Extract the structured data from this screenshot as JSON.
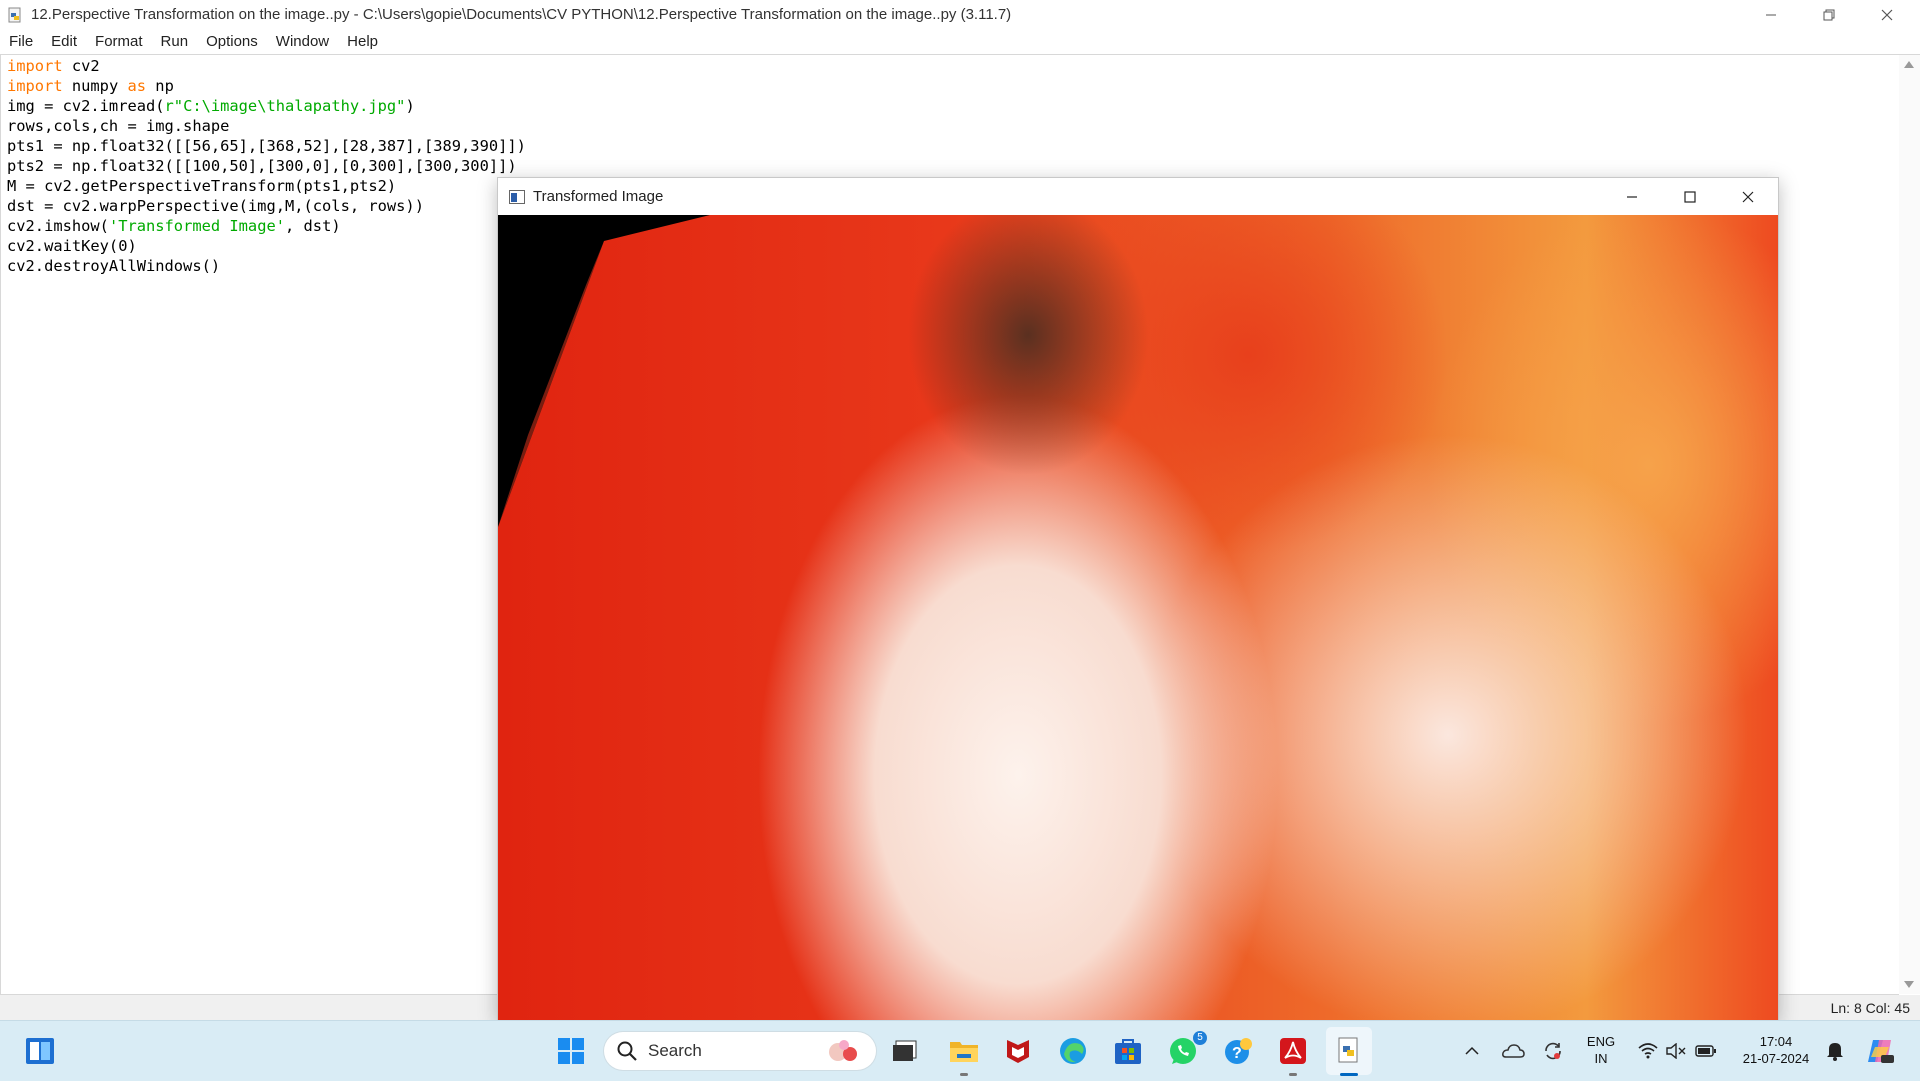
{
  "idle": {
    "title": "12.Perspective Transformation on the image..py - C:\\Users\\gopie\\Documents\\CV PYTHON\\12.Perspective Transformation on the image..py (3.11.7)",
    "menu": [
      "File",
      "Edit",
      "Format",
      "Run",
      "Options",
      "Window",
      "Help"
    ],
    "status": "Ln: 8   Col: 45",
    "code": [
      {
        "kw": "import",
        "rest": " cv2"
      },
      {
        "kw": "import",
        "mid": " numpy ",
        "kw2": "as",
        "rest": " np"
      },
      {
        "pre": "img = cv2.imread(",
        "str": "r\"C:\\image\\thalapathy.jpg\"",
        "post": ")"
      },
      {
        "plain": "rows,cols,ch = img.shape"
      },
      {
        "plain": "pts1 = np.float32([[56,65],[368,52],[28,387],[389,390]])"
      },
      {
        "plain": "pts2 = np.float32([[100,50],[300,0],[0,300],[300,300]])"
      },
      {
        "plain": "M = cv2.getPerspectiveTransform(pts1,pts2)"
      },
      {
        "plain": "dst = cv2.warpPerspective(img,M,(cols, rows))"
      },
      {
        "pre": "cv2.imshow(",
        "str": "'Transformed Image'",
        "post": ", dst)"
      },
      {
        "plain": "cv2.waitKey(0)"
      },
      {
        "plain": "cv2.destroyAllWindows()"
      }
    ]
  },
  "cv_window": {
    "title": "Transformed Image"
  },
  "taskbar": {
    "search_label": "Search",
    "whatsapp_badge": "5",
    "lang_line1": "ENG",
    "lang_line2": "IN",
    "time": "17:04",
    "date": "21-07-2024",
    "icons": [
      "start-icon",
      "search-icon",
      "task-view-icon",
      "file-explorer-icon",
      "mcafee-icon",
      "edge-icon",
      "microsoft-store-icon",
      "whatsapp-icon",
      "get-help-icon",
      "acrobat-icon",
      "python-idle-icon"
    ],
    "accent": "#0067c0"
  }
}
